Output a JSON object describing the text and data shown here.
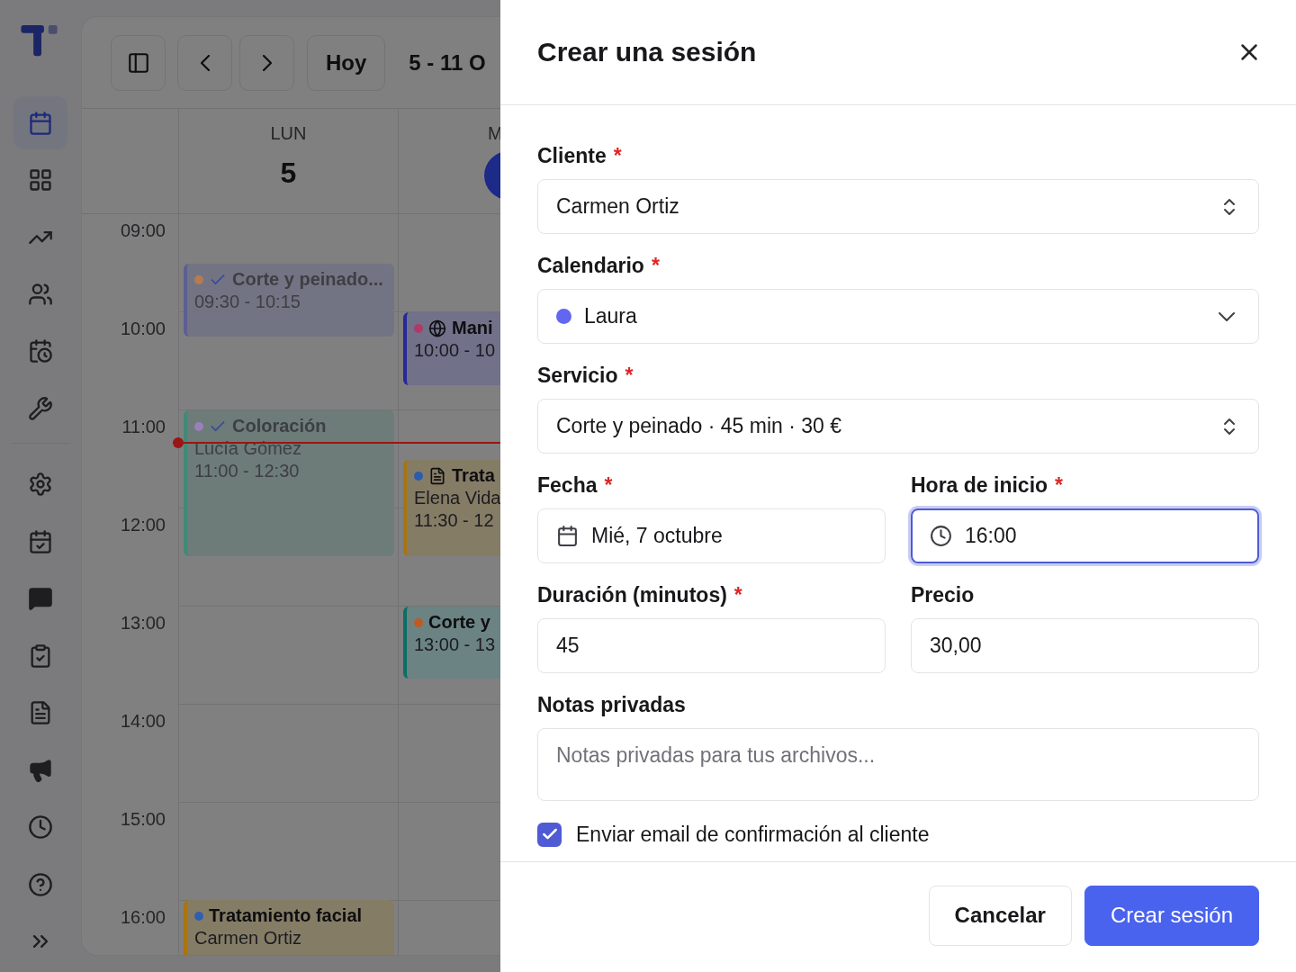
{
  "sidebar": {
    "items": [
      {
        "selected": true
      },
      {
        "selected": false
      },
      {
        "selected": false
      },
      {
        "selected": false
      },
      {
        "selected": false
      },
      {
        "selected": false
      },
      {
        "selected": false
      },
      {
        "selected": false
      },
      {
        "selected": false
      },
      {
        "selected": false
      },
      {
        "selected": false
      },
      {
        "selected": false
      },
      {
        "selected": false
      },
      {
        "selected": false
      },
      {
        "selected": false
      }
    ]
  },
  "toolbar": {
    "today_button": "Hoy",
    "range": "5 - 11 O"
  },
  "calendar": {
    "hours": [
      "09:00",
      "10:00",
      "11:00",
      "12:00",
      "13:00",
      "14:00",
      "15:00",
      "16:00"
    ],
    "now_line": true,
    "days": [
      {
        "weekday": "LUN",
        "date": "5",
        "selected": false,
        "events": [
          {
            "kind": "lavender",
            "title": "Corte y peinado...",
            "time": "09:30 - 10:15",
            "past": true,
            "confirmed": true,
            "online": false,
            "notes": false,
            "color": "#b87a50"
          },
          {
            "kind": "teal",
            "title": "Coloración",
            "client": "Lucía Gómez",
            "time": "11:00 - 12:30",
            "past": true,
            "confirmed": true,
            "online": false,
            "notes": false,
            "color": "#9a80b8"
          },
          {
            "kind": "amber",
            "title": "Tratamiento facial",
            "client": "Carmen Ortiz",
            "past": false,
            "confirmed": false,
            "online": false,
            "notes": false,
            "color": "#2f5fb0"
          }
        ]
      },
      {
        "weekday": "M",
        "selected": true,
        "events": [
          {
            "kind": "indigo",
            "title": "Mani",
            "time": "10:00 - 10",
            "past": false,
            "confirmed": false,
            "online": true,
            "notes": false,
            "color": "#b03a66"
          },
          {
            "kind": "amber",
            "title": "Trata",
            "client": "Elena Vida",
            "time": "11:30 - 12",
            "past": false,
            "confirmed": false,
            "online": false,
            "notes": true,
            "color": "#2a5cb0"
          },
          {
            "kind": "green",
            "title": "Corte y",
            "time": "13:00 - 13",
            "past": false,
            "confirmed": false,
            "online": false,
            "notes": false,
            "color": "#c05a20"
          }
        ]
      }
    ]
  },
  "dialog": {
    "title": "Crear una sesión",
    "fields": [
      {
        "kind": "select",
        "label": "Cliente",
        "required_mark": "*",
        "value": "Carmen Ortiz",
        "focused": false
      },
      {
        "kind": "dropdown",
        "label": "Calendario",
        "required_mark": "*",
        "value": "Laura",
        "color": "#6366f1",
        "focused": false
      },
      {
        "kind": "select",
        "label": "Servicio",
        "required_mark": "*",
        "value": "Corte y peinado · 45 min · 30 €",
        "focused": false
      },
      {
        "kind": "date",
        "label": "Fecha",
        "required_mark": "*",
        "value": "Mié, 7 octubre",
        "focused": false
      },
      {
        "kind": "time",
        "label": "Hora de inicio",
        "required_mark": "*",
        "value": "16:00",
        "focused": true
      },
      {
        "kind": "text",
        "label": "Duración (minutos)",
        "required_mark": "*",
        "value": "45",
        "focused": false
      },
      {
        "kind": "text",
        "label": "Precio",
        "value": "30,00",
        "focused": false
      },
      {
        "kind": "textarea",
        "label": "Notas privadas",
        "placeholder": "Notas privadas para tus archivos...",
        "focused": false
      }
    ],
    "checkbox": {
      "label": "Enviar email de confirmación al cliente",
      "checked": true
    },
    "buttons": [
      {
        "label": "Cancelar",
        "kind": "secondary"
      },
      {
        "label": "Crear sesión",
        "kind": "primary"
      }
    ]
  }
}
